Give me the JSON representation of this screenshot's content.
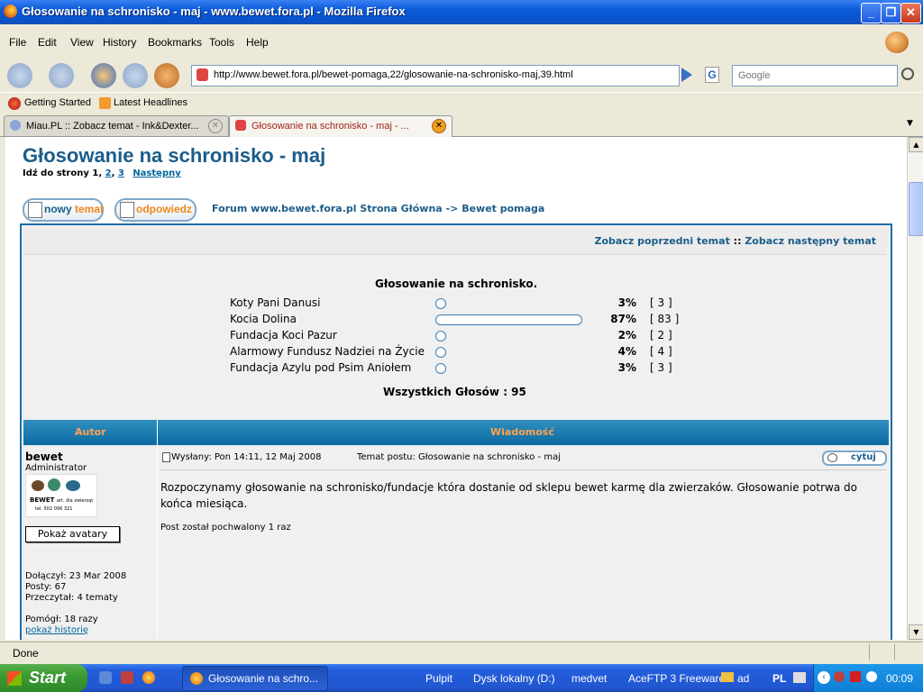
{
  "window": {
    "title": "Głosowanie na schronisko - maj - www.bewet.fora.pl - Mozilla Firefox",
    "min": "_",
    "max": "❐",
    "close": "✕"
  },
  "menu": [
    "File",
    "Edit",
    "View",
    "History",
    "Bookmarks",
    "Tools",
    "Help"
  ],
  "nav": {
    "url": "http://www.bewet.fora.pl/bewet-pomaga,22/glosowanie-na-schronisko-maj,39.html",
    "search_placeholder": "Google"
  },
  "bookmarks": [
    "Getting Started",
    "Latest Headlines"
  ],
  "tabs": [
    {
      "label": "Miau.PL :: Zobacz temat - Ink&Dexter..."
    },
    {
      "label": "Głosowanie na schronisko - maj - ..."
    }
  ],
  "page": {
    "title": "Głosowanie na schronisko - maj",
    "goto_label": "Idź do strony",
    "pages": [
      "1",
      "2",
      "3"
    ],
    "next": "Następny",
    "new_topic": "nowy",
    "new_topic_accent": "temat",
    "reply": "odpowiedz",
    "forum_home": "Forum www.bewet.fora.pl Strona Główna",
    "crumb_sep": "->",
    "forum_section": "Bewet pomaga",
    "prev_topic": "Zobacz poprzedni temat",
    "sep": "::",
    "next_topic": "Zobacz następny temat"
  },
  "poll": {
    "question": "Głosowanie na schronisko.",
    "options": [
      {
        "name": "Koty Pani Danusi",
        "percent": "3%",
        "votes": "[ 3 ]",
        "fraction": 0.03
      },
      {
        "name": "Kocia Dolina",
        "percent": "87%",
        "votes": "[ 83 ]",
        "fraction": 0.87
      },
      {
        "name": "Fundacja Koci Pazur",
        "percent": "2%",
        "votes": "[ 2 ]",
        "fraction": 0.02
      },
      {
        "name": "Alarmowy Fundusz Nadziei na Życie",
        "percent": "4%",
        "votes": "[ 4 ]",
        "fraction": 0.04
      },
      {
        "name": "Fundacja Azylu pod Psim Aniołem",
        "percent": "3%",
        "votes": "[ 3 ]",
        "fraction": 0.03
      }
    ],
    "total": "Wszystkich Głosów : 95"
  },
  "table_headers": {
    "author": "Autor",
    "message": "Wiadomość"
  },
  "post": {
    "author": "bewet",
    "role": "Administrator",
    "avatar_text": "BEWET",
    "avatar_sub": "art. dla zwierząt",
    "avatar_phone": "tel. 502 096 321",
    "show_avatars": "Pokaż avatary",
    "joined": "Dołączył: 23 Mar 2008",
    "posts": "Posty: 67",
    "read": "Przeczytał: 4 tematy",
    "helped": "Pomógł: 18 razy",
    "history": "pokaż historię",
    "sent": "Wysłany: Pon 14:11, 12 Maj 2008",
    "subject": "Temat postu: Głosowanie na schronisko - maj",
    "quote": "cytuj",
    "body": "Rozpoczynamy głosowanie na schronisko/fundacje która dostanie od sklepu bewet karmę dla zwierzaków. Głosowanie potrwa do końca miesiąca.",
    "praise": "Post został pochwalony 1 raz"
  },
  "status": "Done",
  "taskbar": {
    "start": "Start",
    "task": "Głosowanie na schro...",
    "toolbars": [
      "Pulpit",
      "Dysk lokalny (D:)",
      "medvet",
      "AceFTP 3 Freeware",
      "ad"
    ],
    "lang": "PL",
    "clock": "00:09"
  }
}
